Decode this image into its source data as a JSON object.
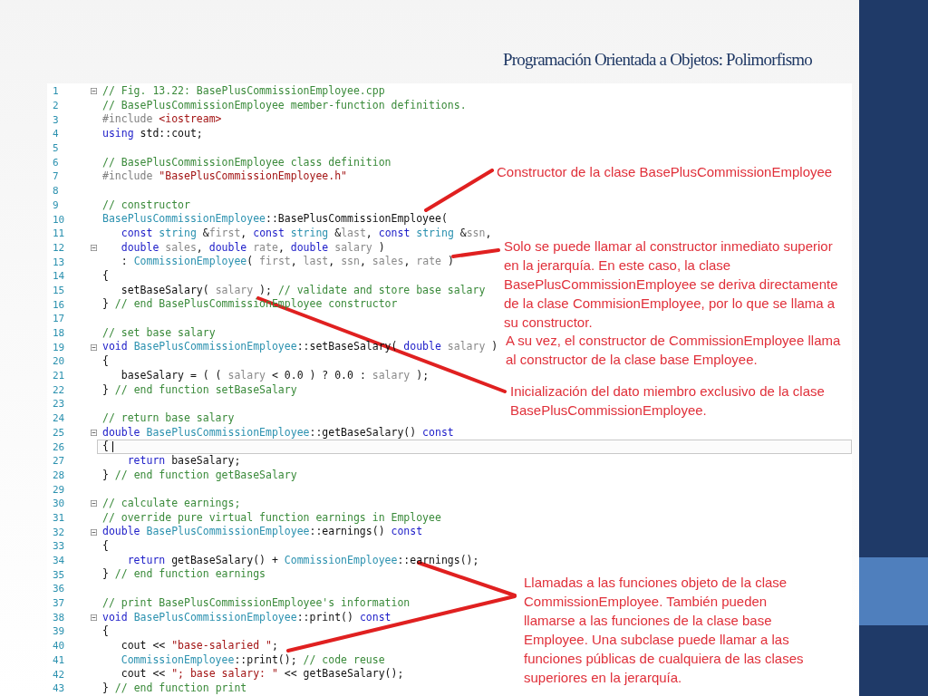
{
  "slide": {
    "title": "Programación Orientada a Objetos: Polimorfismo"
  },
  "code": {
    "lines": [
      {
        "n": "1",
        "fold": true,
        "current": false,
        "tokens": [
          {
            "kind": "comment",
            "text": "// Fig. 13.22: BasePlusCommissionEmployee.cpp"
          }
        ]
      },
      {
        "n": "2",
        "fold": false,
        "current": false,
        "tokens": [
          {
            "kind": "comment",
            "text": "// BasePlusCommissionEmployee member-function definitions."
          }
        ]
      },
      {
        "n": "3",
        "fold": false,
        "current": false,
        "tokens": [
          {
            "kind": "preproc",
            "text": "#include "
          },
          {
            "kind": "string",
            "text": "<iostream>"
          }
        ]
      },
      {
        "n": "4",
        "fold": false,
        "current": false,
        "tokens": [
          {
            "kind": "keyword",
            "text": "using"
          },
          {
            "kind": "plain",
            "text": " std::cout;"
          }
        ]
      },
      {
        "n": "5",
        "fold": false,
        "current": false
      },
      {
        "n": "6",
        "fold": false,
        "current": false,
        "tokens": [
          {
            "kind": "comment",
            "text": "// BasePlusCommissionEmployee class definition"
          }
        ]
      },
      {
        "n": "7",
        "fold": false,
        "current": false,
        "tokens": [
          {
            "kind": "preproc",
            "text": "#include "
          },
          {
            "kind": "string",
            "text": "\"BasePlusCommissionEmployee.h\""
          }
        ]
      },
      {
        "n": "8",
        "fold": false,
        "current": false
      },
      {
        "n": "9",
        "fold": false,
        "current": false,
        "tokens": [
          {
            "kind": "comment",
            "text": "// constructor"
          }
        ]
      },
      {
        "n": "10",
        "fold": false,
        "current": false,
        "tokens": [
          {
            "kind": "type",
            "text": "BasePlusCommissionEmployee"
          },
          {
            "kind": "plain",
            "text": "::BasePlusCommissionEmployee("
          }
        ]
      },
      {
        "n": "11",
        "fold": false,
        "current": false,
        "tokens": [
          {
            "kind": "keyword",
            "text": "   const"
          },
          {
            "kind": "type",
            "text": " string"
          },
          {
            "kind": "plain",
            "text": " &"
          },
          {
            "kind": "param",
            "text": "first"
          },
          {
            "kind": "plain",
            "text": ", "
          },
          {
            "kind": "keyword",
            "text": "const"
          },
          {
            "kind": "type",
            "text": " string"
          },
          {
            "kind": "plain",
            "text": " &"
          },
          {
            "kind": "param",
            "text": "last"
          },
          {
            "kind": "plain",
            "text": ", "
          },
          {
            "kind": "keyword",
            "text": "const"
          },
          {
            "kind": "type",
            "text": " string"
          },
          {
            "kind": "plain",
            "text": " &"
          },
          {
            "kind": "param",
            "text": "ssn"
          },
          {
            "kind": "plain",
            "text": ","
          }
        ]
      },
      {
        "n": "12",
        "fold": true,
        "current": false,
        "tokens": [
          {
            "kind": "keyword",
            "text": "   double"
          },
          {
            "kind": "param",
            "text": " sales"
          },
          {
            "kind": "plain",
            "text": ", "
          },
          {
            "kind": "keyword",
            "text": "double"
          },
          {
            "kind": "param",
            "text": " rate"
          },
          {
            "kind": "plain",
            "text": ", "
          },
          {
            "kind": "keyword",
            "text": "double"
          },
          {
            "kind": "param",
            "text": " salary"
          },
          {
            "kind": "plain",
            "text": " )"
          }
        ]
      },
      {
        "n": "13",
        "fold": false,
        "current": false,
        "tokens": [
          {
            "kind": "plain",
            "text": "   : "
          },
          {
            "kind": "type",
            "text": "CommissionEmployee"
          },
          {
            "kind": "plain",
            "text": "( "
          },
          {
            "kind": "param",
            "text": "first"
          },
          {
            "kind": "plain",
            "text": ", "
          },
          {
            "kind": "param",
            "text": "last"
          },
          {
            "kind": "plain",
            "text": ", "
          },
          {
            "kind": "param",
            "text": "ssn"
          },
          {
            "kind": "plain",
            "text": ", "
          },
          {
            "kind": "param",
            "text": "sales"
          },
          {
            "kind": "plain",
            "text": ", "
          },
          {
            "kind": "param",
            "text": "rate"
          },
          {
            "kind": "plain",
            "text": " )"
          }
        ]
      },
      {
        "n": "14",
        "fold": false,
        "current": false,
        "tokens": [
          {
            "kind": "plain",
            "text": "{"
          }
        ]
      },
      {
        "n": "15",
        "fold": false,
        "current": false,
        "tokens": [
          {
            "kind": "plain",
            "text": "   setBaseSalary( "
          },
          {
            "kind": "param",
            "text": "salary"
          },
          {
            "kind": "plain",
            "text": " ); "
          },
          {
            "kind": "comment",
            "text": "// validate and store base salary"
          }
        ]
      },
      {
        "n": "16",
        "fold": false,
        "current": false,
        "tokens": [
          {
            "kind": "plain",
            "text": "} "
          },
          {
            "kind": "comment",
            "text": "// end BasePlusCommissionEmployee constructor"
          }
        ]
      },
      {
        "n": "17",
        "fold": false,
        "current": false
      },
      {
        "n": "18",
        "fold": false,
        "current": false,
        "tokens": [
          {
            "kind": "comment",
            "text": "// set base salary"
          }
        ]
      },
      {
        "n": "19",
        "fold": true,
        "current": false,
        "tokens": [
          {
            "kind": "keyword",
            "text": "void"
          },
          {
            "kind": "type",
            "text": " BasePlusCommissionEmployee"
          },
          {
            "kind": "plain",
            "text": "::setBaseSalary( "
          },
          {
            "kind": "keyword",
            "text": "double"
          },
          {
            "kind": "param",
            "text": " salary"
          },
          {
            "kind": "plain",
            "text": " )"
          }
        ]
      },
      {
        "n": "20",
        "fold": false,
        "current": false,
        "tokens": [
          {
            "kind": "plain",
            "text": "{"
          }
        ]
      },
      {
        "n": "21",
        "fold": false,
        "current": false,
        "tokens": [
          {
            "kind": "plain",
            "text": "   baseSalary = ( ( "
          },
          {
            "kind": "param",
            "text": "salary"
          },
          {
            "kind": "plain",
            "text": " < 0.0 ) ? 0.0 : "
          },
          {
            "kind": "param",
            "text": "salary"
          },
          {
            "kind": "plain",
            "text": " );"
          }
        ]
      },
      {
        "n": "22",
        "fold": false,
        "current": false,
        "tokens": [
          {
            "kind": "plain",
            "text": "} "
          },
          {
            "kind": "comment",
            "text": "// end function setBaseSalary"
          }
        ]
      },
      {
        "n": "23",
        "fold": false,
        "current": false
      },
      {
        "n": "24",
        "fold": false,
        "current": false,
        "tokens": [
          {
            "kind": "comment",
            "text": "// return base salary"
          }
        ]
      },
      {
        "n": "25",
        "fold": true,
        "current": false,
        "tokens": [
          {
            "kind": "keyword",
            "text": "double"
          },
          {
            "kind": "type",
            "text": " BasePlusCommissionEmployee"
          },
          {
            "kind": "plain",
            "text": "::getBaseSalary() "
          },
          {
            "kind": "keyword",
            "text": "const"
          }
        ]
      },
      {
        "n": "26",
        "fold": false,
        "current": true,
        "tokens": [
          {
            "kind": "plain",
            "text": "{"
          }
        ]
      },
      {
        "n": "27",
        "fold": false,
        "current": false,
        "tokens": [
          {
            "kind": "keyword",
            "text": "    return"
          },
          {
            "kind": "plain",
            "text": " baseSalary;"
          }
        ]
      },
      {
        "n": "28",
        "fold": false,
        "current": false,
        "tokens": [
          {
            "kind": "plain",
            "text": "} "
          },
          {
            "kind": "comment",
            "text": "// end function getBaseSalary"
          }
        ]
      },
      {
        "n": "29",
        "fold": false,
        "current": false
      },
      {
        "n": "30",
        "fold": true,
        "current": false,
        "tokens": [
          {
            "kind": "comment",
            "text": "// calculate earnings;"
          }
        ]
      },
      {
        "n": "31",
        "fold": false,
        "current": false,
        "tokens": [
          {
            "kind": "comment",
            "text": "// override pure virtual function earnings in Employee"
          }
        ]
      },
      {
        "n": "32",
        "fold": true,
        "current": false,
        "tokens": [
          {
            "kind": "keyword",
            "text": "double"
          },
          {
            "kind": "type",
            "text": " BasePlusCommissionEmployee"
          },
          {
            "kind": "plain",
            "text": "::earnings() "
          },
          {
            "kind": "keyword",
            "text": "const"
          }
        ]
      },
      {
        "n": "33",
        "fold": false,
        "current": false,
        "tokens": [
          {
            "kind": "plain",
            "text": "{"
          }
        ]
      },
      {
        "n": "34",
        "fold": false,
        "current": false,
        "tokens": [
          {
            "kind": "keyword",
            "text": "    return"
          },
          {
            "kind": "plain",
            "text": " getBaseSalary() + "
          },
          {
            "kind": "type",
            "text": "CommissionEmployee"
          },
          {
            "kind": "plain",
            "text": "::earnings();"
          }
        ]
      },
      {
        "n": "35",
        "fold": false,
        "current": false,
        "tokens": [
          {
            "kind": "plain",
            "text": "} "
          },
          {
            "kind": "comment",
            "text": "// end function earnings"
          }
        ]
      },
      {
        "n": "36",
        "fold": false,
        "current": false
      },
      {
        "n": "37",
        "fold": false,
        "current": false,
        "tokens": [
          {
            "kind": "comment",
            "text": "// print BasePlusCommissionEmployee's information"
          }
        ]
      },
      {
        "n": "38",
        "fold": true,
        "current": false,
        "tokens": [
          {
            "kind": "keyword",
            "text": "void"
          },
          {
            "kind": "type",
            "text": " BasePlusCommissionEmployee"
          },
          {
            "kind": "plain",
            "text": "::print() "
          },
          {
            "kind": "keyword",
            "text": "const"
          }
        ]
      },
      {
        "n": "39",
        "fold": false,
        "current": false,
        "tokens": [
          {
            "kind": "plain",
            "text": "{"
          }
        ]
      },
      {
        "n": "40",
        "fold": false,
        "current": false,
        "tokens": [
          {
            "kind": "plain",
            "text": "   cout << "
          },
          {
            "kind": "string",
            "text": "\"base-salaried \""
          },
          {
            "kind": "plain",
            "text": ";"
          }
        ]
      },
      {
        "n": "41",
        "fold": false,
        "current": false,
        "tokens": [
          {
            "kind": "type",
            "text": "   CommissionEmployee"
          },
          {
            "kind": "plain",
            "text": "::print(); "
          },
          {
            "kind": "comment",
            "text": "// code reuse"
          }
        ]
      },
      {
        "n": "42",
        "fold": false,
        "current": false,
        "tokens": [
          {
            "kind": "plain",
            "text": "   cout << "
          },
          {
            "kind": "string",
            "text": "\"; base salary: \""
          },
          {
            "kind": "plain",
            "text": " << getBaseSalary();"
          }
        ]
      },
      {
        "n": "43",
        "fold": false,
        "current": false,
        "tokens": [
          {
            "kind": "plain",
            "text": "} "
          },
          {
            "kind": "comment",
            "text": "// end function print"
          }
        ]
      }
    ]
  },
  "annotations": [
    {
      "text": "Constructor de la clase BasePlusCommissionEmployee"
    },
    {
      "text": "Solo se puede llamar al constructor inmediato superior en la jerarquía. En este caso, la clase BasePlusCommissionEmployee se deriva directamente de la clase CommisionEmployee, por lo que se llama a su constructor."
    },
    {
      "text": "A su vez, el constructor de CommissionEmployee llama al constructor de la clase base Employee."
    },
    {
      "text": "Inicialización del dato miembro exclusivo de la clase BasePlusCommissionEmployee."
    },
    {
      "text": "Llamadas a las funciones objeto de la clase CommissionEmployee. También pueden llamarse a las funciones de la clase base Employee. Una subclase puede llamar a las funciones públicas de cualquiera de las clases superiores en la jerarquía."
    }
  ]
}
